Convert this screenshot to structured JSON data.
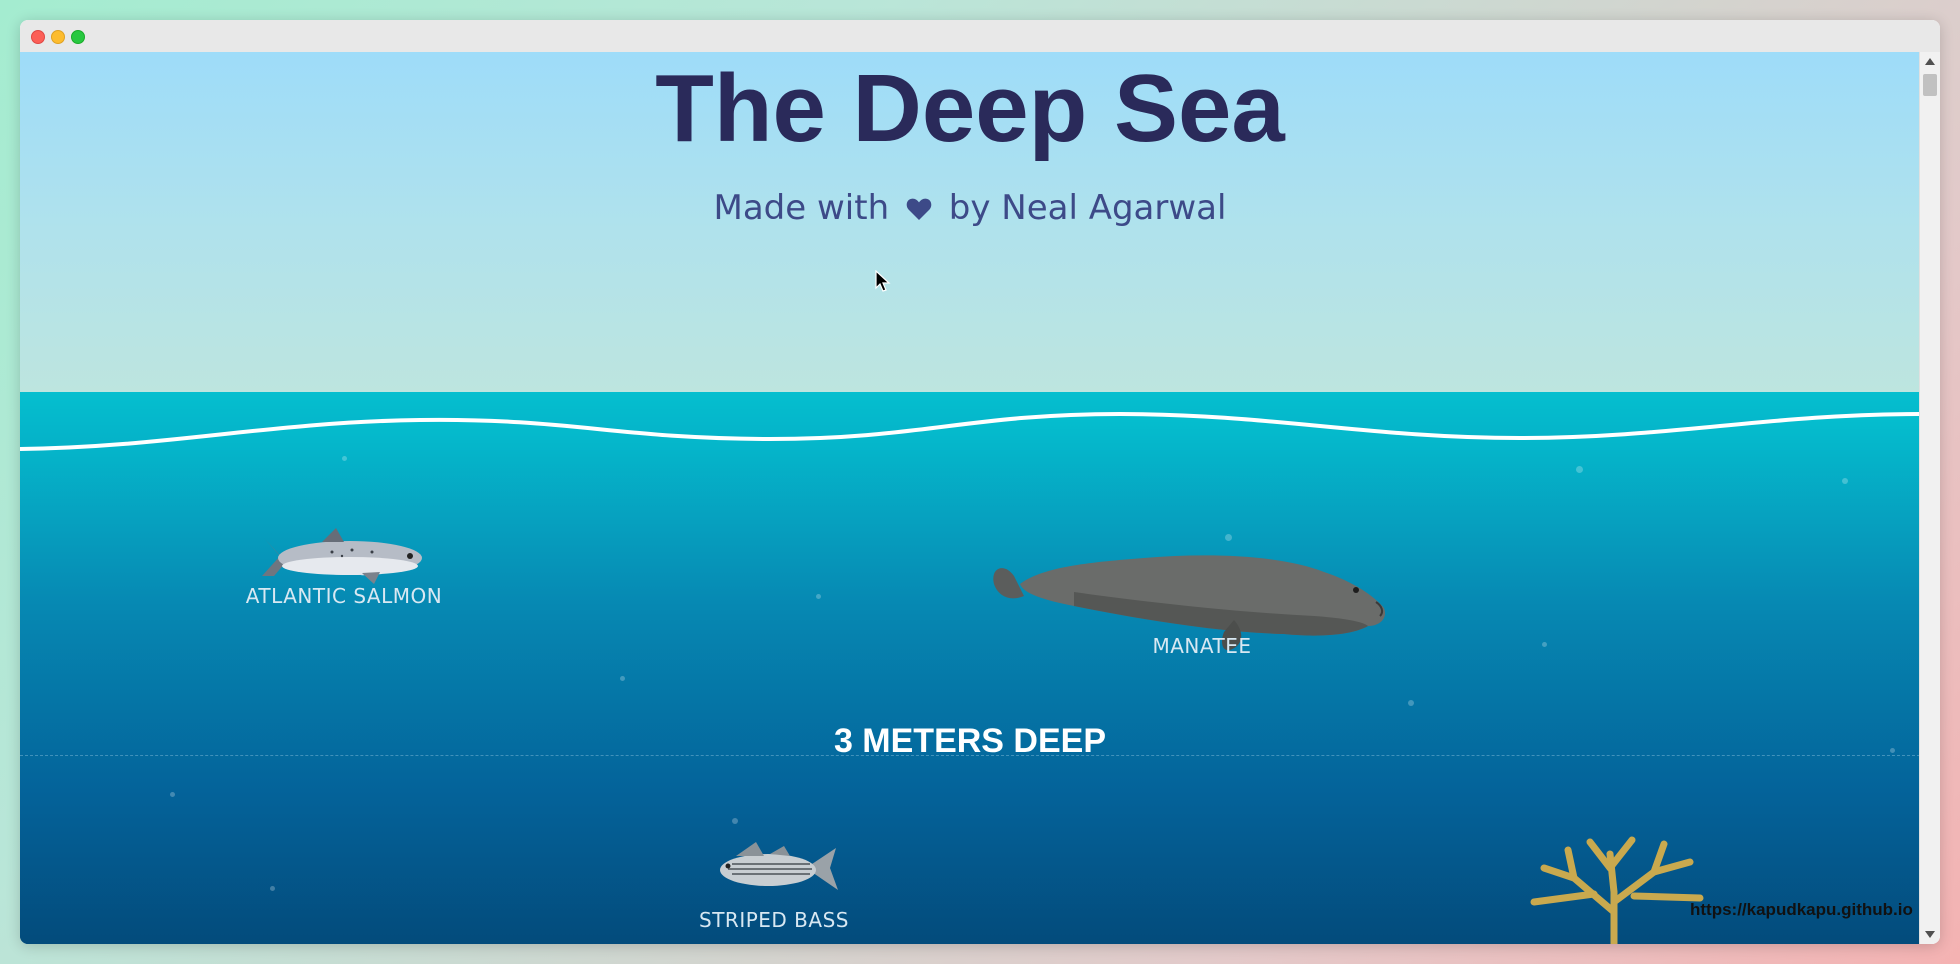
{
  "window": {
    "controls": [
      "close",
      "minimize",
      "maximize"
    ]
  },
  "header": {
    "title": "The Deep Sea",
    "subtitle_prefix": "Made with",
    "subtitle_icon": "heart-icon",
    "subtitle_suffix": "by Neal Agarwal"
  },
  "ocean": {
    "depth_label": "3 METERS DEEP",
    "creatures": [
      {
        "name": "ATLANTIC SALMON",
        "icon": "salmon-image"
      },
      {
        "name": "MANATEE",
        "icon": "manatee-image"
      },
      {
        "name": "STRIPED BASS",
        "icon": "striped-bass-image"
      },
      {
        "name": "",
        "icon": "coral-image"
      }
    ]
  },
  "status": {
    "url": "https://kapudkapu.github.io"
  },
  "colors": {
    "title": "#2a2a5a",
    "subtitle": "#3d4a88",
    "ocean_top": "#05bfcf",
    "ocean_deep": "#034a7a",
    "sky": "#9edcf9"
  }
}
